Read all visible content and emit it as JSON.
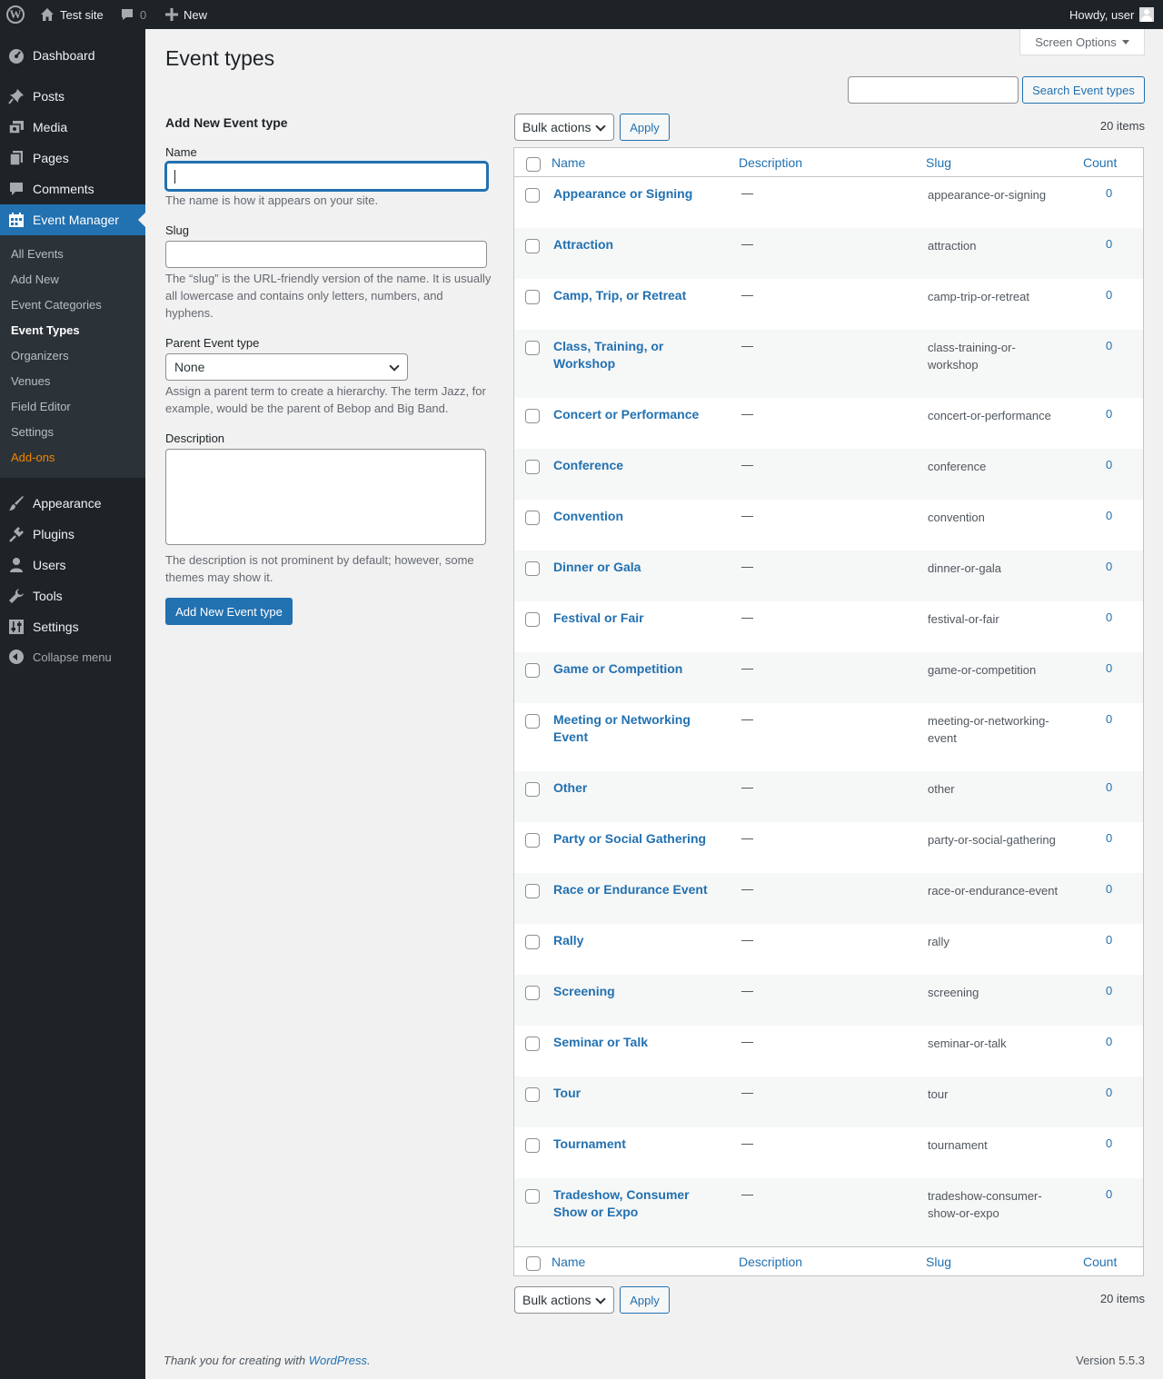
{
  "adminbar": {
    "wp_logo": "W",
    "site_name": "Test site",
    "comments_count": "0",
    "new_label": "New",
    "howdy": "Howdy, user"
  },
  "sidebar": {
    "dashboard": "Dashboard",
    "posts": "Posts",
    "media": "Media",
    "pages": "Pages",
    "comments": "Comments",
    "event_manager": "Event Manager",
    "submenu": [
      "All Events",
      "Add New",
      "Event Categories",
      "Event Types",
      "Organizers",
      "Venues",
      "Field Editor",
      "Settings",
      "Add-ons"
    ],
    "appearance": "Appearance",
    "plugins": "Plugins",
    "users": "Users",
    "tools": "Tools",
    "settings": "Settings",
    "collapse": "Collapse menu"
  },
  "header": {
    "screen_options": "Screen Options",
    "title": "Event types",
    "search_placeholder": "",
    "search_button": "Search Event types"
  },
  "form": {
    "heading": "Add New Event type",
    "name_label": "Name",
    "name_help": "The name is how it appears on your site.",
    "slug_label": "Slug",
    "slug_help": "The “slug” is the URL-friendly version of the name. It is usually all lowercase and contains only letters, numbers, and hyphens.",
    "parent_label": "Parent Event type",
    "parent_value": "None",
    "parent_help": "Assign a parent term to create a hierarchy. The term Jazz, for example, would be the parent of Bebop and Big Band.",
    "description_label": "Description",
    "description_help": "The description is not prominent by default; however, some themes may show it.",
    "submit": "Add New Event type"
  },
  "list": {
    "bulk_actions": "Bulk actions",
    "apply": "Apply",
    "items_count": "20 items",
    "columns": {
      "name": "Name",
      "description": "Description",
      "slug": "Slug",
      "count": "Count"
    },
    "rows": [
      {
        "name": "Appearance or Signing",
        "description": "—",
        "slug": "appearance-or-signing",
        "count": "0"
      },
      {
        "name": "Attraction",
        "description": "—",
        "slug": "attraction",
        "count": "0"
      },
      {
        "name": "Camp, Trip, or Retreat",
        "description": "—",
        "slug": "camp-trip-or-retreat",
        "count": "0"
      },
      {
        "name": "Class, Training, or Workshop",
        "description": "—",
        "slug": "class-training-or-workshop",
        "count": "0"
      },
      {
        "name": "Concert or Performance",
        "description": "—",
        "slug": "concert-or-performance",
        "count": "0"
      },
      {
        "name": "Conference",
        "description": "—",
        "slug": "conference",
        "count": "0"
      },
      {
        "name": "Convention",
        "description": "—",
        "slug": "convention",
        "count": "0"
      },
      {
        "name": "Dinner or Gala",
        "description": "—",
        "slug": "dinner-or-gala",
        "count": "0"
      },
      {
        "name": "Festival or Fair",
        "description": "—",
        "slug": "festival-or-fair",
        "count": "0"
      },
      {
        "name": "Game or Competition",
        "description": "—",
        "slug": "game-or-competition",
        "count": "0"
      },
      {
        "name": "Meeting or Networking Event",
        "description": "—",
        "slug": "meeting-or-networking-event",
        "count": "0"
      },
      {
        "name": "Other",
        "description": "—",
        "slug": "other",
        "count": "0"
      },
      {
        "name": "Party or Social Gathering",
        "description": "—",
        "slug": "party-or-social-gathering",
        "count": "0"
      },
      {
        "name": "Race or Endurance Event",
        "description": "—",
        "slug": "race-or-endurance-event",
        "count": "0"
      },
      {
        "name": "Rally",
        "description": "—",
        "slug": "rally",
        "count": "0"
      },
      {
        "name": "Screening",
        "description": "—",
        "slug": "screening",
        "count": "0"
      },
      {
        "name": "Seminar or Talk",
        "description": "—",
        "slug": "seminar-or-talk",
        "count": "0"
      },
      {
        "name": "Tour",
        "description": "—",
        "slug": "tour",
        "count": "0"
      },
      {
        "name": "Tournament",
        "description": "—",
        "slug": "tournament",
        "count": "0"
      },
      {
        "name": "Tradeshow, Consumer Show or Expo",
        "description": "—",
        "slug": "tradeshow-consumer-show-or-expo",
        "count": "0"
      }
    ]
  },
  "footer": {
    "thanks_prefix": "Thank you for creating with ",
    "wordpress_link": "WordPress",
    "thanks_suffix": ".",
    "version": "Version 5.5.3"
  },
  "colors": {
    "accent": "#2271b1",
    "sidebar_bg": "#1d2327",
    "addons": "#f18500"
  }
}
